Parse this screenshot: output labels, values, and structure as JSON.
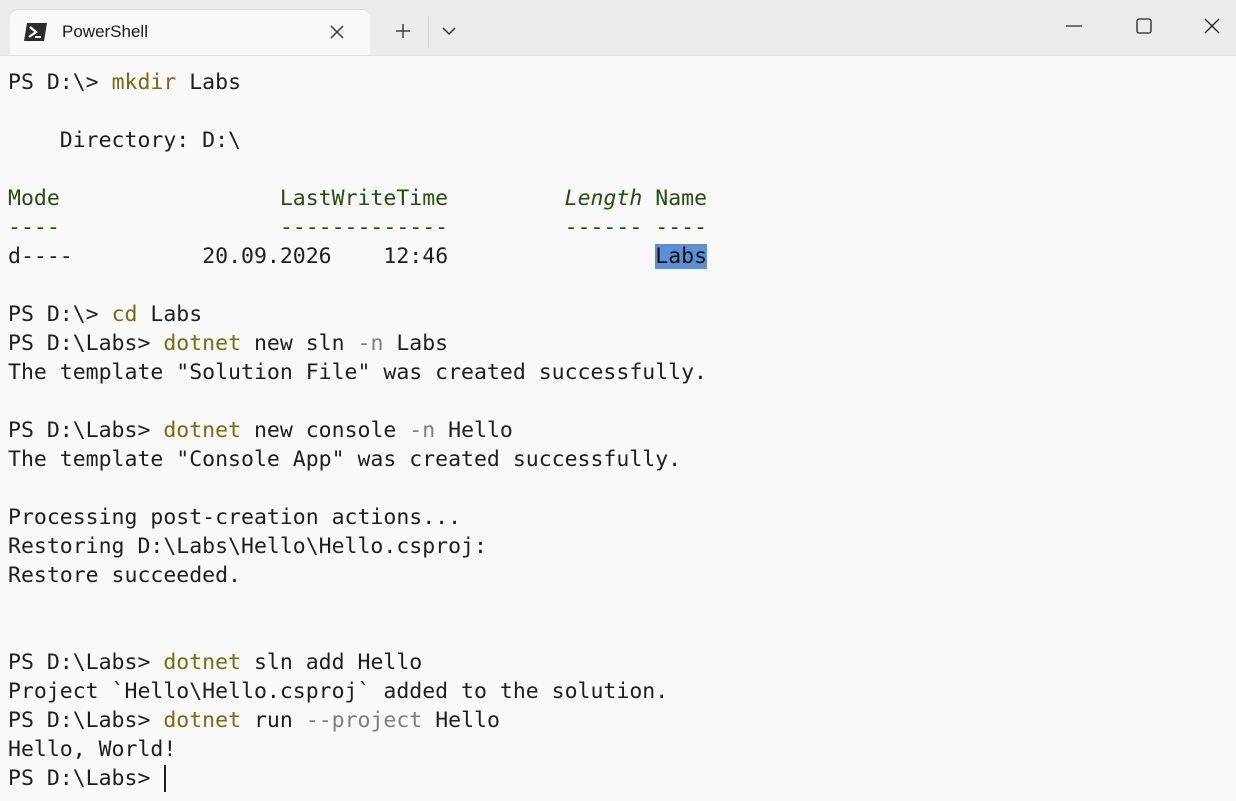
{
  "window": {
    "tab_title": "PowerShell"
  },
  "terminal": {
    "l1": {
      "prompt": "PS D:\\> ",
      "cmd": "mkdir",
      "rest": " Labs"
    },
    "l2": {
      "text": "    Directory: D:\\"
    },
    "l3": {
      "mode": "Mode",
      "gap1": "                 ",
      "lwt": "LastWriteTime",
      "gap2": "         ",
      "length": "Length",
      "gap3": " ",
      "name": "Name"
    },
    "l4": {
      "text": "----                 -------------         ------ ----"
    },
    "l5": {
      "mode": "d----",
      "gap1": "          ",
      "date": "20.09.2026",
      "gap2": "    ",
      "time": "12:46",
      "gap3": "                ",
      "name": "Labs"
    },
    "l6": {
      "prompt": "PS D:\\> ",
      "cmd": "cd",
      "rest": " Labs"
    },
    "l7": {
      "prompt": "PS D:\\Labs> ",
      "cmd": "dotnet",
      "rest1": " new sln ",
      "param": "-n",
      "rest2": " Labs"
    },
    "l8": {
      "text": "The template \"Solution File\" was created successfully."
    },
    "l9": {
      "prompt": "PS D:\\Labs> ",
      "cmd": "dotnet",
      "rest1": " new console ",
      "param": "-n",
      "rest2": " Hello"
    },
    "l10": {
      "text": "The template \"Console App\" was created successfully."
    },
    "l11": {
      "text": "Processing post-creation actions..."
    },
    "l12": {
      "text": "Restoring D:\\Labs\\Hello\\Hello.csproj:"
    },
    "l13": {
      "text": "Restore succeeded."
    },
    "l14": {
      "prompt": "PS D:\\Labs> ",
      "cmd": "dotnet",
      "rest": " sln add Hello"
    },
    "l15": {
      "text": "Project `Hello\\Hello.csproj` added to the solution."
    },
    "l16": {
      "prompt": "PS D:\\Labs> ",
      "cmd": "dotnet",
      "rest1": " run ",
      "param": "--project",
      "rest2": " Hello"
    },
    "l17": {
      "text": "Hello, World!"
    },
    "l18": {
      "prompt": "PS D:\\Labs> "
    }
  },
  "colors": {
    "background": "#f9f9f9",
    "command": "#7a6a12",
    "parameter": "#7d7d7d",
    "table_header": "#264d12",
    "selection": "#5b8fd6"
  },
  "icons": {
    "tab": "powershell-icon",
    "close_tab": "close-icon",
    "new_tab": "plus-icon",
    "dropdown": "chevron-down-icon",
    "minimize": "minimize-icon",
    "maximize": "maximize-icon",
    "close_window": "close-icon"
  }
}
